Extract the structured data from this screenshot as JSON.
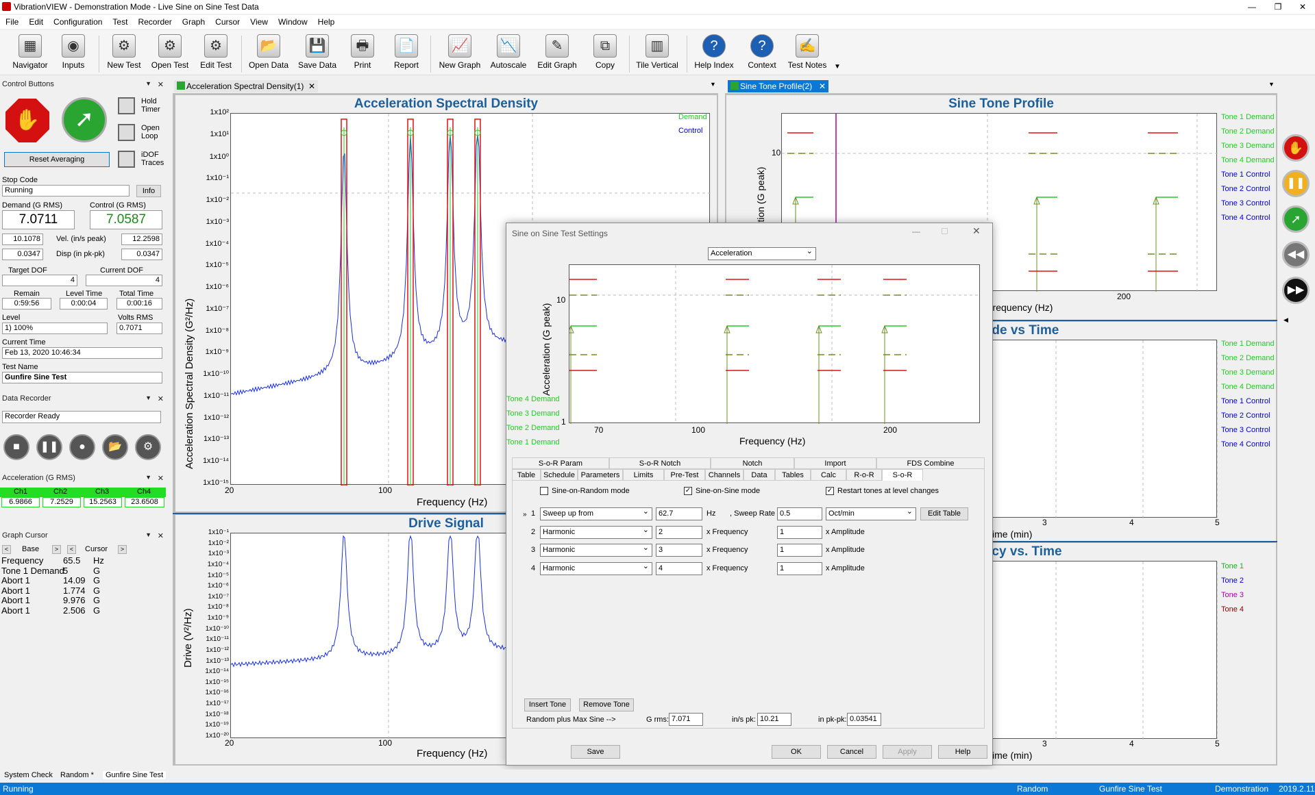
{
  "window": {
    "title": "VibrationVIEW - Demonstration Mode - Live Sine on Sine Test Data",
    "min": "—",
    "restore": "❐",
    "close": "✕"
  },
  "menu": [
    "File",
    "Edit",
    "Configuration",
    "Test",
    "Recorder",
    "Graph",
    "Cursor",
    "View",
    "Window",
    "Help"
  ],
  "toolbar": [
    {
      "label": "Navigator",
      "icon": "▦"
    },
    {
      "label": "Inputs",
      "icon": "◉"
    },
    {
      "label": "New Test",
      "icon": "⚙"
    },
    {
      "label": "Open Test",
      "icon": "⚙"
    },
    {
      "label": "Edit Test",
      "icon": "⚙"
    },
    {
      "label": "Open Data",
      "icon": "📂"
    },
    {
      "label": "Save Data",
      "icon": "💾"
    },
    {
      "label": "Print",
      "icon": "🖶"
    },
    {
      "label": "Report",
      "icon": "📄"
    },
    {
      "label": "New Graph",
      "icon": "📈"
    },
    {
      "label": "Autoscale",
      "icon": "📉"
    },
    {
      "label": "Edit Graph",
      "icon": "✎"
    },
    {
      "label": "Copy",
      "icon": "⧉"
    },
    {
      "label": "Tile Vertical",
      "icon": "▥"
    },
    {
      "label": "Help Index",
      "icon": "?"
    },
    {
      "label": "Context",
      "icon": "?"
    },
    {
      "label": "Test Notes",
      "icon": "✍"
    }
  ],
  "control": {
    "header": "Control Buttons",
    "hold_timer": "Hold Timer",
    "open_loop": "Open Loop",
    "idof": "iDOF Traces",
    "reset": "Reset Averaging",
    "stop_code_label": "Stop Code",
    "stop_code": "Running",
    "info": "Info",
    "demand_label": "Demand (G RMS)",
    "demand": "7.0711",
    "control_label": "Control (G RMS)",
    "control": "7.0587",
    "vel_label": "Vel. (in/s peak)",
    "vel_d": "10.1078",
    "vel_c": "12.2598",
    "disp_label": "Disp (in pk-pk)",
    "disp_d": "0.0347",
    "disp_c": "0.0347",
    "target_dof_label": "Target DOF",
    "target_dof": "4",
    "current_dof_label": "Current DOF",
    "current_dof": "4",
    "remain_label": "Remain",
    "remain": "0:59:56",
    "level_time_label": "Level Time",
    "level_time": "0:00:04",
    "total_time_label": "Total Time",
    "total_time": "0:00:16",
    "level_label": "Level",
    "level": "1) 100%",
    "volts_label": "Volts RMS",
    "volts": "0.7071",
    "time_label": "Current Time",
    "time": "Feb 13, 2020 10:46:34",
    "test_name_label": "Test Name",
    "test_name": "Gunfire Sine Test"
  },
  "recorder": {
    "header": "Data Recorder",
    "status": "Recorder Ready"
  },
  "accel": {
    "header": "Acceleration (G RMS)",
    "ch": [
      "Ch1",
      "Ch2",
      "Ch3",
      "Ch4"
    ],
    "vals": [
      "6.9866",
      "7.2529",
      "15.2563",
      "23.6508"
    ]
  },
  "cursor": {
    "header": "Graph Cursor",
    "base": "Base",
    "cursor": "Cursor",
    "lt": "<",
    "gt": ">",
    "rows": [
      [
        "Frequency",
        "65.5",
        "Hz"
      ],
      [
        "Tone 1 Demand",
        "5",
        "G"
      ],
      [
        "Abort 1",
        "14.09",
        "G"
      ],
      [
        "Abort 1",
        "1.774",
        "G"
      ],
      [
        "Abort 1",
        "9.976",
        "G"
      ],
      [
        "Abort 1",
        "2.506",
        "G"
      ]
    ]
  },
  "tabs": {
    "asd": "Acceleration Spectral Density(1)",
    "stp": "Sine Tone Profile(2)"
  },
  "asd": {
    "title": "Acceleration Spectral Density",
    "ylabel": "Acceleration Spectral Density (G²/Hz)",
    "xlabel": "Frequency (Hz)",
    "yticks": [
      "1x10²",
      "1x10¹",
      "1x10⁰",
      "1x10⁻¹",
      "1x10⁻²",
      "1x10⁻³",
      "1x10⁻⁴",
      "1x10⁻⁵",
      "1x10⁻⁶",
      "1x10⁻⁷",
      "1x10⁻⁸",
      "1x10⁻⁹",
      "1x10⁻¹⁰",
      "1x10⁻¹¹",
      "1x10⁻¹²",
      "1x10⁻¹³",
      "1x10⁻¹⁴",
      "1x10⁻¹⁵"
    ],
    "xticks": [
      "20",
      "100"
    ],
    "legend": [
      "Demand",
      "Control"
    ]
  },
  "drive": {
    "title": "Drive Signal",
    "ylabel": "Drive (V²/Hz)",
    "xlabel": "Frequency (Hz)",
    "yticks": [
      "1x10⁻¹",
      "1x10⁻²",
      "1x10⁻³",
      "1x10⁻⁴",
      "1x10⁻⁵",
      "1x10⁻⁶",
      "1x10⁻⁷",
      "1x10⁻⁸",
      "1x10⁻⁹",
      "1x10⁻¹⁰",
      "1x10⁻¹¹",
      "1x10⁻¹²",
      "1x10⁻¹³",
      "1x10⁻¹⁴",
      "1x10⁻¹⁵",
      "1x10⁻¹⁶",
      "1x10⁻¹⁷",
      "1x10⁻¹⁸",
      "1x10⁻¹⁹",
      "1x10⁻²⁰"
    ],
    "xticks": [
      "20",
      "100"
    ]
  },
  "stp": {
    "title": "Sine Tone Profile",
    "ylabel": "Acceleration (G peak)",
    "xlabel": "Frequency (Hz)",
    "ytick": "10",
    "xtick": "200",
    "legend": [
      "Tone 1 Demand",
      "Tone 2 Demand",
      "Tone 3 Demand",
      "Tone 4 Demand",
      "Tone 1 Control",
      "Tone 2 Control",
      "Tone 3 Control",
      "Tone 4 Control"
    ]
  },
  "avt": {
    "title": "Amplitude vs Time",
    "xlabel": "Time (min)",
    "xticks": [
      "3",
      "4",
      "5"
    ],
    "legend": [
      "Tone 1 Demand",
      "Tone 2 Demand",
      "Tone 3 Demand",
      "Tone 4 Demand",
      "Tone 1 Control",
      "Tone 2 Control",
      "Tone 3 Control",
      "Tone 4 Control"
    ]
  },
  "fvt": {
    "title": "Frequency vs. Time",
    "xlabel": "Time (min)",
    "xticks": [
      "3",
      "4",
      "5"
    ],
    "legend": [
      "Tone 1",
      "Tone 2",
      "Tone 3",
      "Tone 4"
    ]
  },
  "dialog": {
    "title": "Sine on Sine Test Settings",
    "mode": "Acceleration",
    "ylabel": "Acceleration (G peak)",
    "xlabel": "Frequency (Hz)",
    "yticks": [
      "10",
      "1"
    ],
    "xticks": [
      "70",
      "100",
      "200"
    ],
    "legend": [
      "Tone 4 Demand",
      "Tone 3 Demand",
      "Tone 2 Demand",
      "Tone 1 Demand"
    ],
    "tabs_top": [
      "S-o-R Param",
      "S-o-R Notch",
      "Notch",
      "Import",
      "FDS Combine"
    ],
    "tabs_bot": [
      "Table",
      "Schedule",
      "Parameters",
      "Limits",
      "Pre-Test",
      "Channels",
      "Data",
      "Tables",
      "Calc",
      "R-o-R",
      "S-o-R"
    ],
    "sor_random": "Sine-on-Random mode",
    "sos": "Sine-on-Sine mode",
    "restart": "Restart tones at level changes",
    "rows": [
      {
        "n": "1",
        "type": "Sweep up from",
        "val": "62.7",
        "unit": "Hz"
      },
      {
        "n": "2",
        "type": "Harmonic",
        "val": "2",
        "unit": "x Frequency",
        "amp": "1",
        "amp_unit": "x Amplitude"
      },
      {
        "n": "3",
        "type": "Harmonic",
        "val": "3",
        "unit": "x Frequency",
        "amp": "1",
        "amp_unit": "x Amplitude"
      },
      {
        "n": "4",
        "type": "Harmonic",
        "val": "4",
        "unit": "x Frequency",
        "amp": "1",
        "amp_unit": "x Amplitude"
      }
    ],
    "sweep_label": ", Sweep Rate",
    "sweep_rate": "0.5",
    "sweep_unit": "Oct/min",
    "edit_table": "Edit Table",
    "insert": "Insert Tone",
    "remove": "Remove Tone",
    "rpms": "Random plus Max Sine -->",
    "grms_l": "G rms:",
    "grms": "7.071",
    "ins_l": "in/s pk:",
    "ins": "10.21",
    "inpk_l": "in pk-pk:",
    "inpk": "0.03541",
    "save": "Save",
    "ok": "OK",
    "cancel": "Cancel",
    "apply": "Apply",
    "help": "Help",
    "row_marker": "»"
  },
  "bottom_tabs": [
    "System Check",
    "Random *",
    "Gunfire Sine Test"
  ],
  "status": {
    "left": "Running",
    "mode": "Random",
    "test": "Gunfire Sine Test",
    "demo": "Demonstration",
    "ver": "2019.2.11"
  }
}
